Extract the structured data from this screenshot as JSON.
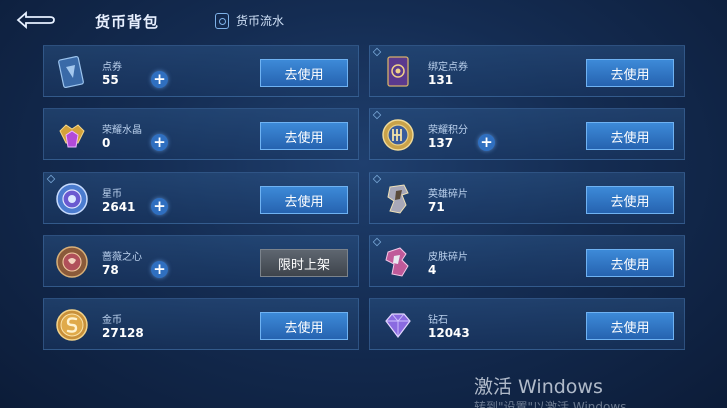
{
  "header": {
    "title": "货币背包",
    "tab_flow_label": "货币流水"
  },
  "buttons": {
    "use_label": "去使用",
    "limited_label": "限时上架"
  },
  "currencies": [
    {
      "name": "点券",
      "amount": "55",
      "icon": "coupon-card-icon"
    },
    {
      "name": "绑定点券",
      "amount": "131",
      "icon": "bound-coupon-card-icon"
    },
    {
      "name": "荣耀水晶",
      "amount": "0",
      "icon": "glory-crystal-icon"
    },
    {
      "name": "荣耀积分",
      "amount": "137",
      "icon": "glory-points-icon"
    },
    {
      "name": "星币",
      "amount": "2641",
      "icon": "star-coin-icon"
    },
    {
      "name": "英雄碎片",
      "amount": "71",
      "icon": "hero-shard-icon"
    },
    {
      "name": "蔷薇之心",
      "amount": "78",
      "icon": "rose-heart-icon"
    },
    {
      "name": "皮肤碎片",
      "amount": "4",
      "icon": "skin-shard-icon"
    },
    {
      "name": "金币",
      "amount": "27128",
      "icon": "gold-coin-icon"
    },
    {
      "name": "钻石",
      "amount": "12043",
      "icon": "diamond-icon"
    }
  ],
  "watermark": {
    "line1": "激活 Windows",
    "line2": "转到\"设置\"以激活 Windows。"
  }
}
